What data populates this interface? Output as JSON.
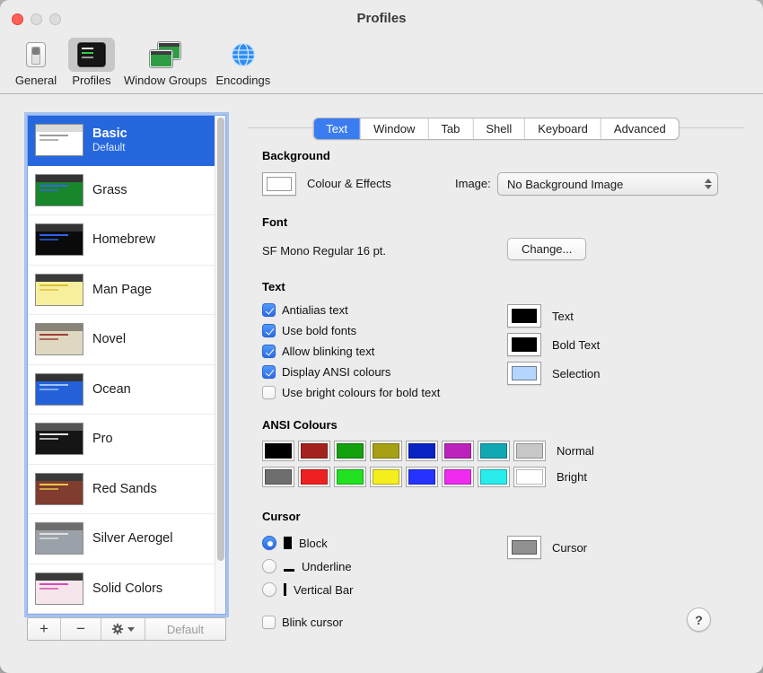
{
  "window": {
    "title": "Profiles"
  },
  "toolbar": {
    "items": [
      {
        "label": "General",
        "selected": false
      },
      {
        "label": "Profiles",
        "selected": true
      },
      {
        "label": "Window Groups",
        "selected": false
      },
      {
        "label": "Encodings",
        "selected": false
      }
    ]
  },
  "profiles": {
    "items": [
      {
        "name": "Basic",
        "subtitle": "Default",
        "selected": true,
        "thumb": {
          "bg": "#ffffff",
          "bar": "#d9d9d9",
          "lines": "#9a9a9a"
        }
      },
      {
        "name": "Grass",
        "thumb": {
          "bg": "#19862c",
          "bar": "#333333",
          "lines": "#3a66e0"
        }
      },
      {
        "name": "Homebrew",
        "thumb": {
          "bg": "#0a0a0a",
          "bar": "#333333",
          "lines": "#2e62e8"
        }
      },
      {
        "name": "Man Page",
        "thumb": {
          "bg": "#f7ef9e",
          "bar": "#3a3a3a",
          "lines": "#d8c234"
        }
      },
      {
        "name": "Novel",
        "thumb": {
          "bg": "#ded8c1",
          "bar": "#8a8378",
          "lines": "#a04038"
        }
      },
      {
        "name": "Ocean",
        "thumb": {
          "bg": "#2461d8",
          "bar": "#333333",
          "lines": "#9ec1ff"
        }
      },
      {
        "name": "Pro",
        "thumb": {
          "bg": "#151515",
          "bar": "#555555",
          "lines": "#e6e6e6"
        }
      },
      {
        "name": "Red Sands",
        "thumb": {
          "bg": "#803c2e",
          "bar": "#3a3a3a",
          "lines": "#e8c84c"
        }
      },
      {
        "name": "Silver Aerogel",
        "thumb": {
          "bg": "#9ba1a8",
          "bar": "#6e6e6e",
          "lines": "#e0e0e0"
        }
      },
      {
        "name": "Solid Colors",
        "thumb": {
          "bg": "#f6e6ec",
          "bar": "#3a3a3a",
          "lines": "#d84cb0"
        }
      }
    ],
    "footer": {
      "add": "+",
      "remove": "−",
      "default_label": "Default"
    }
  },
  "tabs": {
    "selected": "Text",
    "items": [
      "Text",
      "Window",
      "Tab",
      "Shell",
      "Keyboard",
      "Advanced"
    ]
  },
  "background": {
    "heading": "Background",
    "colour_label": "Colour & Effects",
    "image_label": "Image:",
    "image_value": "No Background Image"
  },
  "font": {
    "heading": "Font",
    "value": "SF Mono Regular 16 pt.",
    "change_label": "Change..."
  },
  "text": {
    "heading": "Text",
    "checkboxes": [
      {
        "label": "Antialias text",
        "checked": true
      },
      {
        "label": "Use bold fonts",
        "checked": true
      },
      {
        "label": "Allow blinking text",
        "checked": true
      },
      {
        "label": "Display ANSI colours",
        "checked": true
      },
      {
        "label": "Use bright colours for bold text",
        "checked": false
      }
    ],
    "wells": [
      {
        "label": "Text",
        "color": "#000000"
      },
      {
        "label": "Bold Text",
        "color": "#000000"
      },
      {
        "label": "Selection",
        "color": "#b5d5ff"
      }
    ]
  },
  "ansi": {
    "heading": "ANSI Colours",
    "rows": [
      {
        "label": "Normal",
        "colors": [
          "#000000",
          "#a3221d",
          "#13a10e",
          "#a8a014",
          "#0a23c4",
          "#bc23bc",
          "#11a8b4",
          "#c7c7c7"
        ]
      },
      {
        "label": "Bright",
        "colors": [
          "#6e6e6e",
          "#ef2020",
          "#21e121",
          "#f5ee1f",
          "#2433ff",
          "#ee2bee",
          "#29eded",
          "#ffffff"
        ]
      }
    ]
  },
  "cursor": {
    "heading": "Cursor",
    "options": [
      {
        "label": "Block",
        "glyph": "block",
        "selected": true
      },
      {
        "label": "Underline",
        "glyph": "underline",
        "selected": false
      },
      {
        "label": "Vertical Bar",
        "glyph": "bar",
        "selected": false
      }
    ],
    "blink": {
      "label": "Blink cursor",
      "checked": false
    },
    "well_label": "Cursor",
    "well_color": "#919191"
  },
  "help": {
    "label": "?"
  }
}
